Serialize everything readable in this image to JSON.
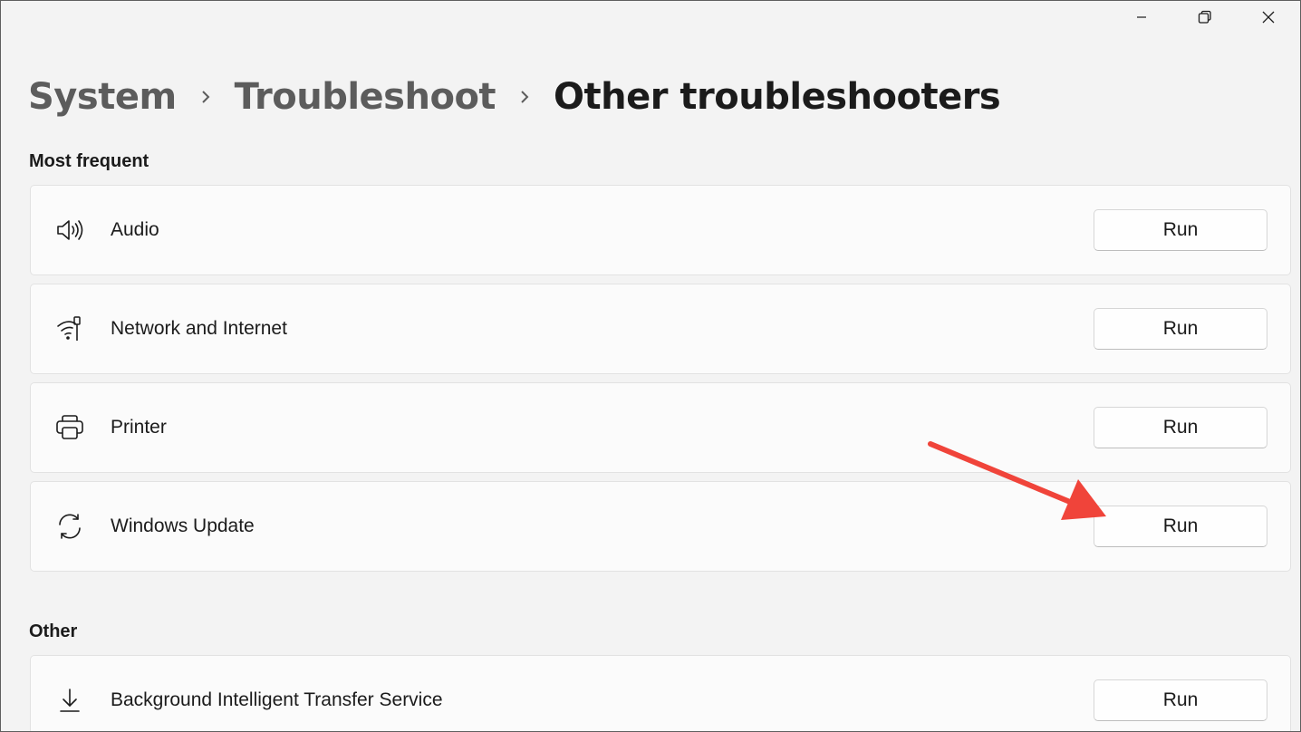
{
  "window": {
    "controls": {
      "minimize_icon": "minimize-icon",
      "restore_icon": "restore-icon",
      "close_icon": "close-icon"
    }
  },
  "breadcrumb": {
    "items": [
      "System",
      "Troubleshoot"
    ],
    "current": "Other troubleshooters",
    "separator_icon": "chevron-right-icon"
  },
  "sections": {
    "most_frequent": {
      "title": "Most frequent",
      "items": [
        {
          "label": "Audio",
          "icon": "speaker-icon",
          "button": "Run"
        },
        {
          "label": "Network and Internet",
          "icon": "network-icon",
          "button": "Run"
        },
        {
          "label": "Printer",
          "icon": "printer-icon",
          "button": "Run"
        },
        {
          "label": "Windows Update",
          "icon": "sync-icon",
          "button": "Run"
        }
      ]
    },
    "other": {
      "title": "Other",
      "items": [
        {
          "label": "Background Intelligent Transfer Service",
          "icon": "download-icon",
          "button": "Run"
        }
      ]
    }
  },
  "annotation": {
    "type": "arrow",
    "color": "#f0443a",
    "target": "windows-update-run-button"
  },
  "colors": {
    "background": "#f3f3f3",
    "card": "#fbfbfb",
    "card_border": "#e2e2e2",
    "text_primary": "#1b1b1b",
    "text_secondary": "#5c5c5c"
  }
}
